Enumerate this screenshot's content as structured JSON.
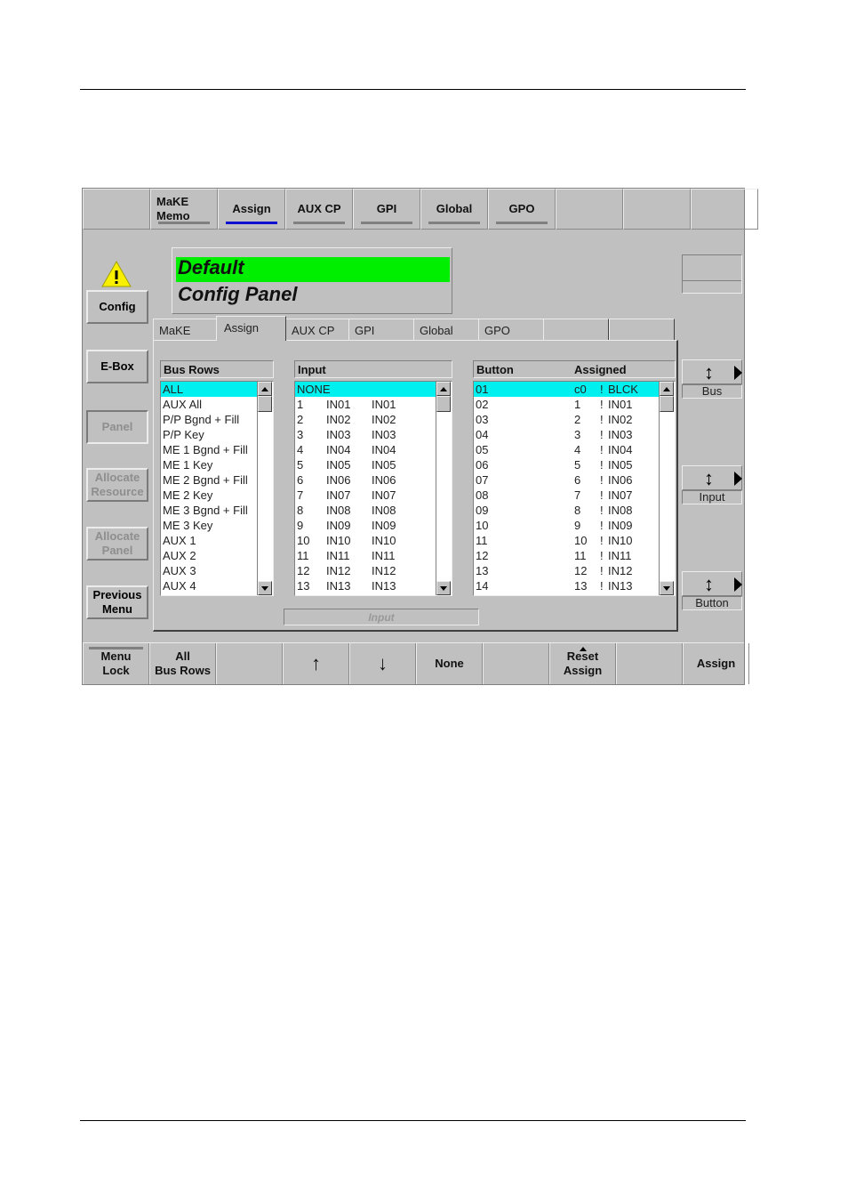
{
  "topbar": {
    "items": [
      {
        "label": "",
        "underline": false
      },
      {
        "label": "MaKE\nMemo",
        "underline": true,
        "active": false
      },
      {
        "label": "Assign",
        "underline": true,
        "active": true
      },
      {
        "label": "AUX CP",
        "underline": true,
        "active": false
      },
      {
        "label": "GPI",
        "underline": true,
        "active": false
      },
      {
        "label": "Global",
        "underline": true,
        "active": false
      },
      {
        "label": "GPO",
        "underline": true,
        "active": false
      },
      {
        "label": "",
        "underline": false
      },
      {
        "label": "",
        "underline": false
      },
      {
        "label": "",
        "underline": false
      }
    ]
  },
  "title": {
    "line1": "Default",
    "line2": "Config Panel",
    "highlight_color": "#00ee00"
  },
  "left_buttons": [
    {
      "label": "Config",
      "enabled": true
    },
    {
      "label": "E-Box",
      "enabled": true
    },
    {
      "label": "Panel",
      "enabled": false
    },
    {
      "label": "Allocate Resource",
      "enabled": false
    },
    {
      "label": "Allocate Panel",
      "enabled": false
    },
    {
      "label": "Previous Menu",
      "enabled": true
    }
  ],
  "tabs": [
    {
      "label": "MaKE",
      "active": false
    },
    {
      "label": "Assign",
      "active": true
    },
    {
      "label": "AUX CP",
      "active": false
    },
    {
      "label": "GPI",
      "active": false
    },
    {
      "label": "Global",
      "active": false
    },
    {
      "label": "GPO",
      "active": false
    },
    {
      "label": "",
      "active": false
    },
    {
      "label": "",
      "active": false
    }
  ],
  "bus_rows": {
    "header": "Bus Rows",
    "selected_index": 0,
    "items": [
      "ALL",
      "AUX All",
      "P/P Bgnd + Fill",
      "P/P Key",
      "ME 1 Bgnd + Fill",
      "ME 1 Key",
      "ME 2 Bgnd + Fill",
      "ME 2 Key",
      "ME 3 Bgnd + Fill",
      "ME 3 Key",
      "AUX 1",
      "AUX 2",
      "AUX 3",
      "AUX 4"
    ]
  },
  "input_list": {
    "header": "Input",
    "selected_index": 0,
    "items": [
      [
        "NONE",
        "",
        ""
      ],
      [
        "1",
        "IN01",
        "IN01"
      ],
      [
        "2",
        "IN02",
        "IN02"
      ],
      [
        "3",
        "IN03",
        "IN03"
      ],
      [
        "4",
        "IN04",
        "IN04"
      ],
      [
        "5",
        "IN05",
        "IN05"
      ],
      [
        "6",
        "IN06",
        "IN06"
      ],
      [
        "7",
        "IN07",
        "IN07"
      ],
      [
        "8",
        "IN08",
        "IN08"
      ],
      [
        "9",
        "IN09",
        "IN09"
      ],
      [
        "10",
        "IN10",
        "IN10"
      ],
      [
        "11",
        "IN11",
        "IN11"
      ],
      [
        "12",
        "IN12",
        "IN12"
      ],
      [
        "13",
        "IN13",
        "IN13"
      ]
    ]
  },
  "button_list": {
    "header_button": "Button",
    "header_assigned": "Assigned",
    "selected_index": 0,
    "items": [
      [
        "01",
        "c0",
        "!",
        "BLCK"
      ],
      [
        "02",
        "1",
        "!",
        "IN01"
      ],
      [
        "03",
        "2",
        "!",
        "IN02"
      ],
      [
        "04",
        "3",
        "!",
        "IN03"
      ],
      [
        "05",
        "4",
        "!",
        "IN04"
      ],
      [
        "06",
        "5",
        "!",
        "IN05"
      ],
      [
        "07",
        "6",
        "!",
        "IN06"
      ],
      [
        "08",
        "7",
        "!",
        "IN07"
      ],
      [
        "09",
        "8",
        "!",
        "IN08"
      ],
      [
        "10",
        "9",
        "!",
        "IN09"
      ],
      [
        "11",
        "10",
        "!",
        "IN10"
      ],
      [
        "12",
        "11",
        "!",
        "IN11"
      ],
      [
        "13",
        "12",
        "!",
        "IN12"
      ],
      [
        "14",
        "13",
        "!",
        "IN13"
      ]
    ]
  },
  "input_field": {
    "value": "Input"
  },
  "spinners": [
    {
      "label": "Bus",
      "icon": "up-down-arrow-icon"
    },
    {
      "label": "Input",
      "icon": "up-down-arrow-icon"
    },
    {
      "label": "Button",
      "icon": "up-down-arrow-icon"
    }
  ],
  "bottombar": {
    "items": [
      {
        "label": "Menu\nLock",
        "topline": true
      },
      {
        "label": "All\nBus Rows"
      },
      {
        "label": ""
      },
      {
        "label": "",
        "icon": "up-arrow-icon",
        "glyph": "↑"
      },
      {
        "label": "",
        "icon": "down-arrow-icon",
        "glyph": "↓"
      },
      {
        "label": "None"
      },
      {
        "label": ""
      },
      {
        "label": "Reset\nAssign",
        "caret": true
      },
      {
        "label": ""
      },
      {
        "label": "Assign"
      }
    ]
  },
  "colors": {
    "background": "#c0c0c0",
    "selection": "#00f0f0",
    "active_underline": "#1010d0"
  }
}
